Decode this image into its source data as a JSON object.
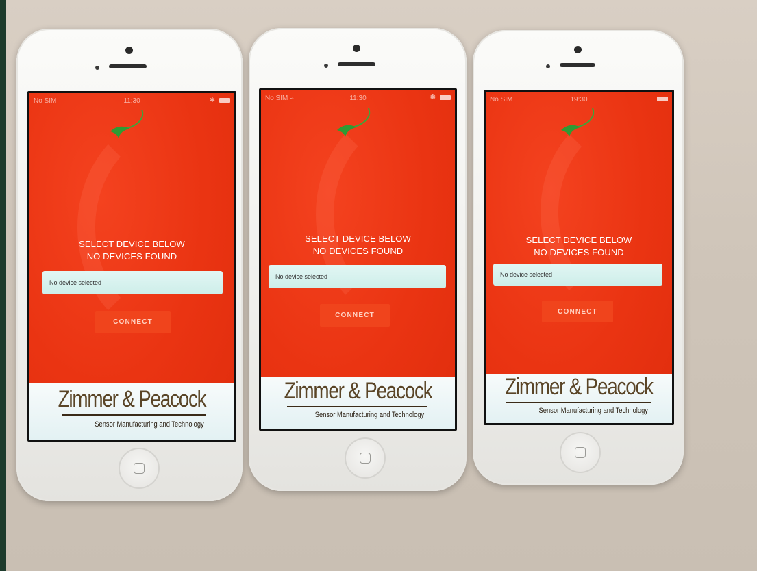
{
  "phones": [
    {
      "status": {
        "carrier": "No SIM",
        "time": "11:30"
      },
      "app": {
        "prompt_line1": "SELECT DEVICE BELOW",
        "prompt_line2": "NO DEVICES FOUND",
        "device_field": "No device selected",
        "connect_label": "CONNECT",
        "brand_name": "Zimmer & Peacock",
        "brand_tagline": "Sensor Manufacturing and Technology"
      }
    },
    {
      "status": {
        "carrier": "No SIM",
        "time": "11:30"
      },
      "app": {
        "prompt_line1": "SELECT DEVICE BELOW",
        "prompt_line2": "NO DEVICES FOUND",
        "device_field": "No device selected",
        "connect_label": "CONNECT",
        "brand_name": "Zimmer & Peacock",
        "brand_tagline": "Sensor Manufacturing and Technology"
      }
    },
    {
      "status": {
        "carrier": "No SIM",
        "time": "19:30"
      },
      "app": {
        "prompt_line1": "SELECT DEVICE BELOW",
        "prompt_line2": "NO DEVICES FOUND",
        "device_field": "No device selected",
        "connect_label": "CONNECT",
        "brand_name": "Zimmer & Peacock",
        "brand_tagline": "Sensor Manufacturing and Technology"
      }
    }
  ],
  "colors": {
    "app_background": "#e8330f",
    "device_field": "#d7f2ef",
    "connect_button": "#f0441c",
    "brand_text": "#5a4527",
    "logo_green": "#3aa63a"
  },
  "icons": [
    "bluetooth-icon",
    "battery-icon",
    "wifi-icon",
    "leaf-logo-icon",
    "home-button-icon"
  ]
}
